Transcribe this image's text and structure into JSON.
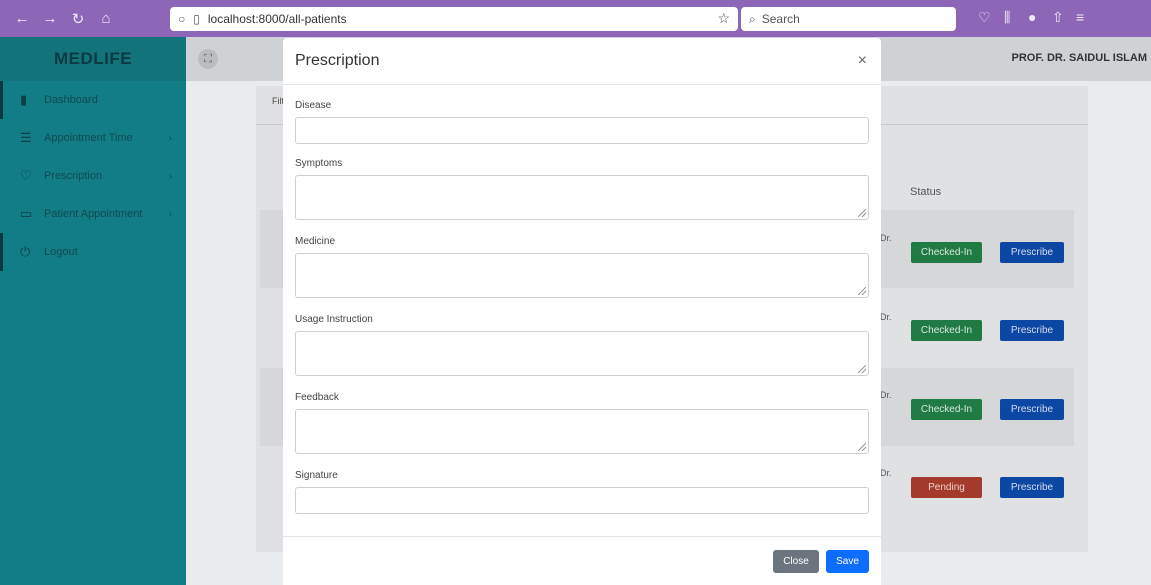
{
  "browser": {
    "url": "localhost:8000/all-patients",
    "search_placeholder": "Search"
  },
  "app": {
    "brand": "MEDLIFE",
    "user_name": "PROF. DR. SAIDUL ISLAM"
  },
  "sidebar": {
    "items": [
      {
        "label": "Dashboard",
        "icon": "bar-chart-icon",
        "has_arrow": false
      },
      {
        "label": "Appointment Time",
        "icon": "list-icon",
        "has_arrow": true
      },
      {
        "label": "Prescription",
        "icon": "heart-icon",
        "has_arrow": true
      },
      {
        "label": "Patient Appointment",
        "icon": "monitor-icon",
        "has_arrow": true
      },
      {
        "label": "Logout",
        "icon": "power-icon",
        "has_arrow": false
      }
    ]
  },
  "background": {
    "filter_label": "Filt",
    "columns": {
      "partial": "r",
      "status": "Status"
    },
    "rows": [
      {
        "doctor_partial": "Dr.",
        "status": "Checked-In",
        "action": "Prescribe"
      },
      {
        "doctor_partial": "Dr.",
        "status": "Checked-In",
        "action": "Prescribe"
      },
      {
        "doctor_partial": "Dr.",
        "status": "Checked-In",
        "action": "Prescribe"
      },
      {
        "doctor_partial": "Dr.",
        "status": "Pending",
        "action": "Prescribe"
      }
    ]
  },
  "modal": {
    "title": "Prescription",
    "close_symbol": "×",
    "fields": {
      "disease": {
        "label": "Disease",
        "value": ""
      },
      "symptoms": {
        "label": "Symptoms",
        "value": ""
      },
      "medicine": {
        "label": "Medicine",
        "value": ""
      },
      "usage": {
        "label": "Usage Instruction",
        "value": ""
      },
      "feedback": {
        "label": "Feedback",
        "value": ""
      },
      "signature": {
        "label": "Signature",
        "value": ""
      }
    },
    "close_button": "Close",
    "save_button": "Save"
  },
  "colors": {
    "browser_bar": "#8e66b8",
    "sidebar": "#137d86",
    "checked_in": "#1f7a44",
    "pending": "#a33a2c",
    "prescribe": "#0d47a4",
    "save": "#0d6efd",
    "close": "#6c757d"
  }
}
